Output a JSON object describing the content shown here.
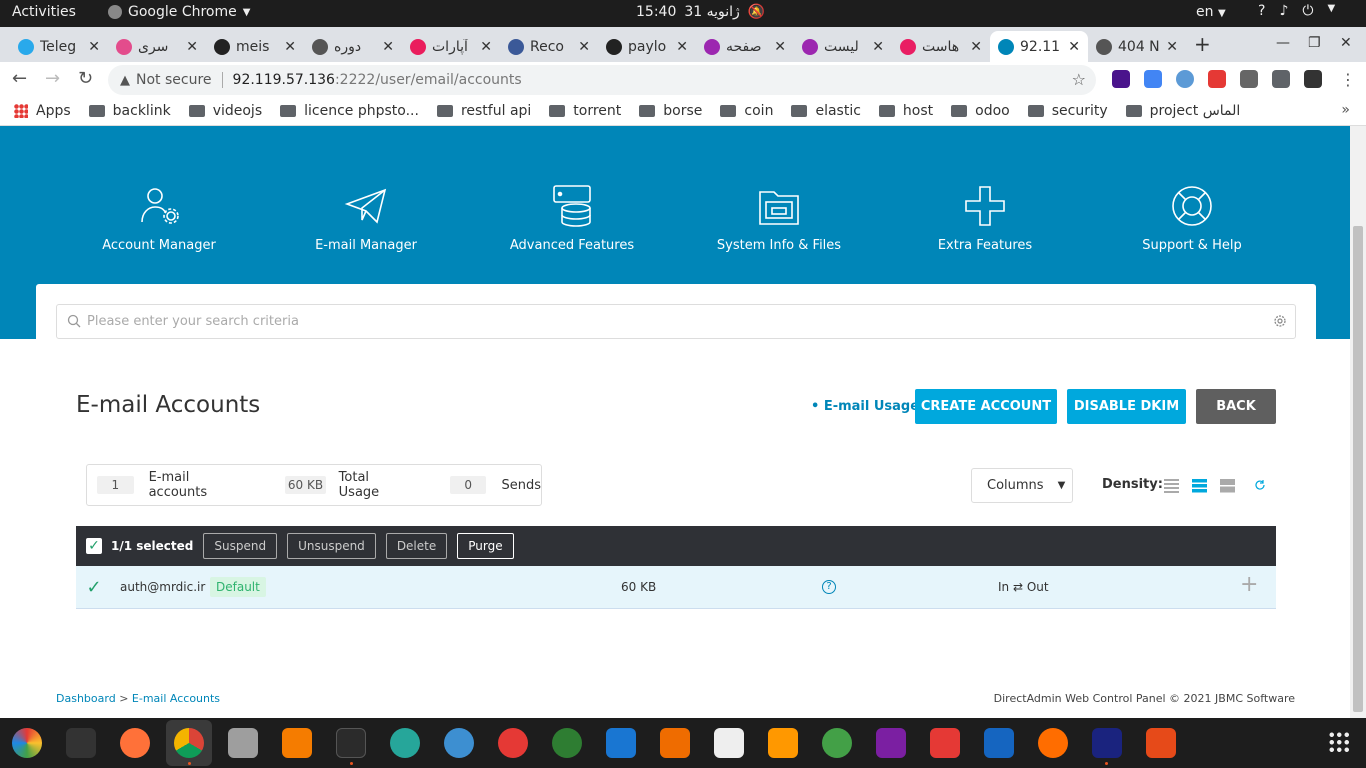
{
  "gnome": {
    "activities": "Activities",
    "app_name": "Google Chrome",
    "time": "15:40",
    "date": "31 ژانویه",
    "language": "en"
  },
  "tabs": [
    {
      "title": "Teleg",
      "color": "#29a9eb"
    },
    {
      "title": "سری",
      "color": "#e34c8c"
    },
    {
      "title": "meis",
      "color": "#222222"
    },
    {
      "title": "دوره",
      "color": "#555555"
    },
    {
      "title": "آپارات",
      "color": "#ea1d5d"
    },
    {
      "title": "Reco",
      "color": "#3b5998"
    },
    {
      "title": "paylo",
      "color": "#222222"
    },
    {
      "title": "صفحه",
      "color": "#9c27b0"
    },
    {
      "title": "لیست",
      "color": "#9c27b0"
    },
    {
      "title": "هاست",
      "color": "#e91e63"
    },
    {
      "title": "92.11",
      "color": "#0086b8"
    },
    {
      "title": "404 N",
      "color": "#555555"
    }
  ],
  "omnibox": {
    "security": "Not secure",
    "host": "92.119.57.136",
    "path": ":2222/user/email/accounts"
  },
  "bookmarks": [
    "Apps",
    "backlink",
    "videojs",
    "licence phpsto...",
    "restful api",
    "torrent",
    "borse",
    "coin",
    "elastic",
    "host",
    "odoo",
    "security",
    "project الماس"
  ],
  "menu": [
    {
      "label": "Account Manager",
      "icon": "users-gear-icon"
    },
    {
      "label": "E-mail Manager",
      "icon": "paper-plane-icon"
    },
    {
      "label": "Advanced Features",
      "icon": "database-server-icon"
    },
    {
      "label": "System Info & Files",
      "icon": "folder-icon"
    },
    {
      "label": "Extra Features",
      "icon": "plus-icon"
    },
    {
      "label": "Support & Help",
      "icon": "lifebuoy-icon"
    }
  ],
  "search": {
    "placeholder": "Please enter your search criteria"
  },
  "page_title": "E-mail Accounts",
  "usage_link": "• E-mail Usage",
  "buttons": {
    "create": "CREATE ACCOUNT",
    "disable_dkim": "DISABLE DKIM",
    "back": "BACK"
  },
  "stats": {
    "accounts_count": "1",
    "accounts_label": "E-mail accounts",
    "usage_value": "60 KB",
    "usage_label": "Total Usage",
    "sends_value": "0",
    "sends_label": "Sends"
  },
  "columns_label": "Columns",
  "density_label": "Density:",
  "selection": {
    "label": "1/1 selected",
    "actions": [
      "Suspend",
      "Unsuspend",
      "Delete",
      "Purge"
    ]
  },
  "rows": [
    {
      "email": "auth@mrdic.ir",
      "badge": "Default",
      "size": "60 KB",
      "direction": "In ⇄ Out"
    }
  ],
  "footer": {
    "crumb_home": "Dashboard",
    "crumb_sep": ">",
    "crumb_current": "E-mail Accounts",
    "copyright": "DirectAdmin Web Control Panel © 2021 JBMC Software"
  },
  "colors": {
    "brand": "#0086b8",
    "button": "#00a8dd",
    "back": "#555555"
  }
}
